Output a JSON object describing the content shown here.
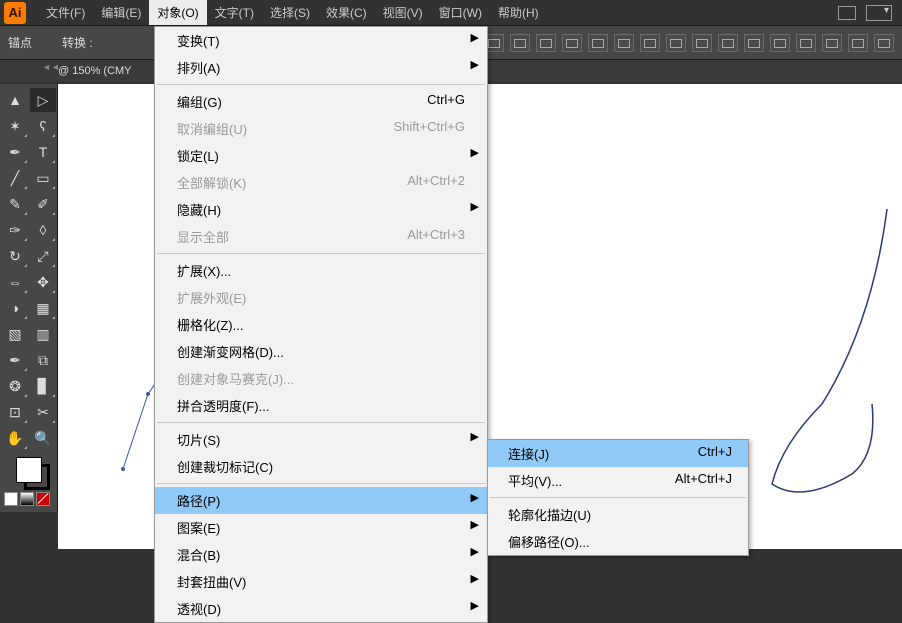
{
  "app": {
    "logo": "Ai"
  },
  "menus": [
    "文件(F)",
    "编辑(E)",
    "对象(O)",
    "文字(T)",
    "选择(S)",
    "效果(C)",
    "视图(V)",
    "窗口(W)",
    "帮助(H)"
  ],
  "controlbar": {
    "anchor": "锚点",
    "convert": "转换 :"
  },
  "tab": {
    "label": "@ 150% (CMY"
  },
  "collapse": "◄◄",
  "dropdown": [
    {
      "label": "变换(T)",
      "sub": true
    },
    {
      "label": "排列(A)",
      "sub": true
    },
    {
      "sep": true
    },
    {
      "label": "编组(G)",
      "short": "Ctrl+G"
    },
    {
      "label": "取消编组(U)",
      "short": "Shift+Ctrl+G",
      "disabled": true
    },
    {
      "label": "锁定(L)",
      "sub": true
    },
    {
      "label": "全部解锁(K)",
      "short": "Alt+Ctrl+2",
      "disabled": true
    },
    {
      "label": "隐藏(H)",
      "sub": true
    },
    {
      "label": "显示全部",
      "short": "Alt+Ctrl+3",
      "disabled": true
    },
    {
      "sep": true
    },
    {
      "label": "扩展(X)..."
    },
    {
      "label": "扩展外观(E)",
      "disabled": true
    },
    {
      "label": "栅格化(Z)..."
    },
    {
      "label": "创建渐变网格(D)..."
    },
    {
      "label": "创建对象马赛克(J)...",
      "disabled": true
    },
    {
      "label": "拼合透明度(F)..."
    },
    {
      "sep": true
    },
    {
      "label": "切片(S)",
      "sub": true
    },
    {
      "label": "创建裁切标记(C)"
    },
    {
      "sep": true
    },
    {
      "label": "路径(P)",
      "sub": true,
      "highlight": true
    },
    {
      "label": "图案(E)",
      "sub": true
    },
    {
      "label": "混合(B)",
      "sub": true
    },
    {
      "label": "封套扭曲(V)",
      "sub": true
    },
    {
      "label": "透视(D)",
      "sub": true
    }
  ],
  "submenu": [
    {
      "label": "连接(J)",
      "short": "Ctrl+J",
      "highlight": true
    },
    {
      "label": "平均(V)...",
      "short": "Alt+Ctrl+J"
    },
    {
      "sep": true
    },
    {
      "label": "轮廓化描边(U)"
    },
    {
      "label": "偏移路径(O)..."
    }
  ],
  "tools": [
    "select",
    "direct-select",
    "wand",
    "lasso",
    "pen",
    "type",
    "line",
    "rect",
    "brush",
    "pencil",
    "blob",
    "eraser",
    "rotate",
    "scale",
    "width",
    "free",
    "shape-build",
    "perspective",
    "mesh",
    "gradient",
    "eyedrop",
    "blend",
    "symbol",
    "graph",
    "artboard",
    "slice",
    "hand",
    "zoom"
  ]
}
